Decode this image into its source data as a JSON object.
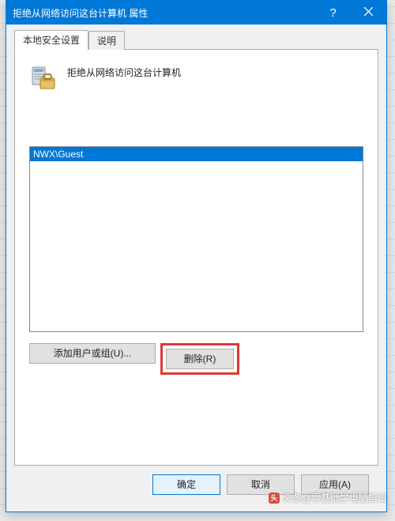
{
  "window": {
    "title": "拒绝从网络访问这台计算机 属性"
  },
  "tabs": {
    "active": "本地安全设置",
    "inactive": "说明"
  },
  "policy": {
    "title": "拒绝从网络访问这台计算机"
  },
  "list": {
    "items": [
      "NWX\\Guest"
    ]
  },
  "buttons": {
    "add": "添加用户或组(U)...",
    "remove": "删除(R)",
    "ok": "确定",
    "cancel": "取消",
    "apply": "应用(A)"
  },
  "watermark": {
    "text": "头条@零基础学电脑常识"
  }
}
